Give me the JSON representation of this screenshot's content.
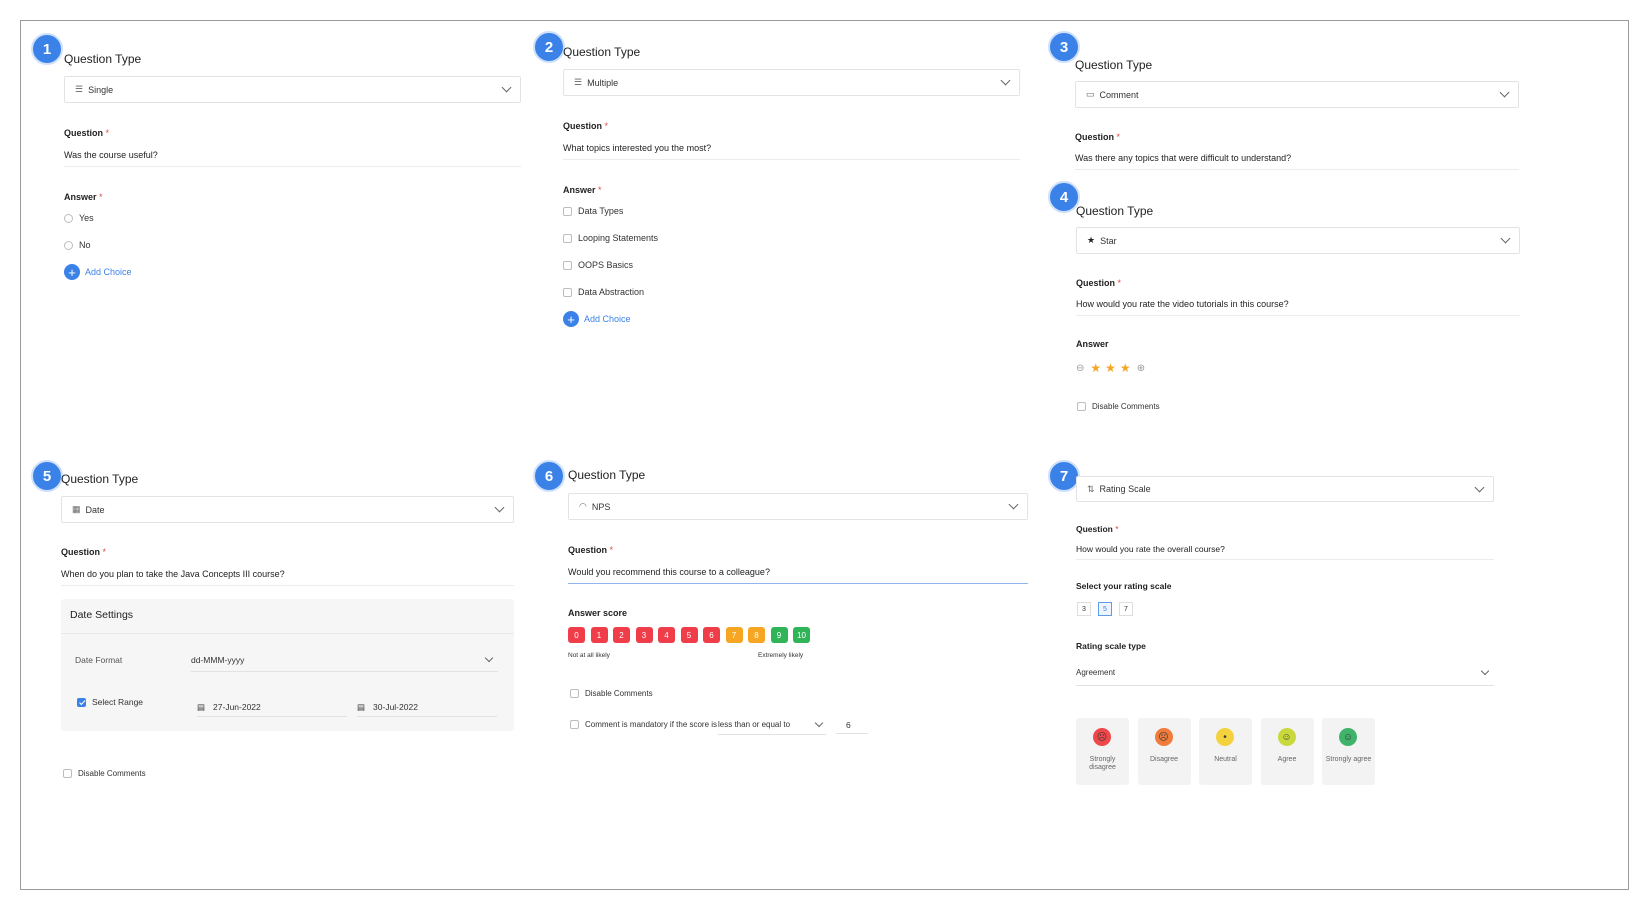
{
  "panel1": {
    "badge": "1",
    "question_type_label": "Question Type",
    "type_value": "Single",
    "type_icon": "list-icon",
    "question_label": "Question",
    "required_mark": "*",
    "question_text": "Was the course useful?",
    "answer_label": "Answer",
    "choices": [
      "Yes",
      "No"
    ],
    "add_choice": "Add Choice"
  },
  "panel2": {
    "badge": "2",
    "question_type_label": "Question Type",
    "type_value": "Multiple",
    "type_icon": "list-icon",
    "question_label": "Question",
    "required_mark": "*",
    "question_text": "What topics interested you the most?",
    "answer_label": "Answer",
    "choices": [
      "Data Types",
      "Looping Statements",
      "OOPS Basics",
      "Data Abstraction"
    ],
    "add_choice": "Add Choice"
  },
  "panel3": {
    "badge": "3",
    "question_type_label": "Question Type",
    "type_value": "Comment",
    "type_icon": "comment-icon",
    "question_label": "Question",
    "required_mark": "*",
    "question_text": "Was there any topics that were difficult to understand?"
  },
  "panel4": {
    "badge": "4",
    "question_type_label": "Question Type",
    "type_value": "Star",
    "type_icon": "star-icon",
    "question_label": "Question",
    "required_mark": "*",
    "question_text": "How would you rate the video tutorials in this course?",
    "answer_label": "Answer",
    "star_count": 3,
    "disable_comments": "Disable Comments"
  },
  "panel5": {
    "badge": "5",
    "question_type_label": "Question Type",
    "type_value": "Date",
    "type_icon": "calendar-icon",
    "question_label": "Question",
    "required_mark": "*",
    "question_text": "When do you plan to take the Java Concepts III course?",
    "date_settings_title": "Date Settings",
    "date_format_label": "Date Format",
    "date_format_value": "dd-MMM-yyyy",
    "select_range_label": "Select Range",
    "select_range_checked": true,
    "start_date": "27-Jun-2022",
    "end_date": "30-Jul-2022",
    "disable_comments": "Disable Comments"
  },
  "panel6": {
    "badge": "6",
    "question_type_label": "Question Type",
    "type_value": "NPS",
    "type_icon": "gauge-icon",
    "question_label": "Question",
    "required_mark": "*",
    "question_text": "Would you recommend this course to a colleague?",
    "answer_score_label": "Answer score",
    "scores": [
      {
        "value": "0",
        "color": "#ef3e4a"
      },
      {
        "value": "1",
        "color": "#ef3e4a"
      },
      {
        "value": "2",
        "color": "#ef3e4a"
      },
      {
        "value": "3",
        "color": "#ef3e4a"
      },
      {
        "value": "4",
        "color": "#ef3e4a"
      },
      {
        "value": "5",
        "color": "#ef3e4a"
      },
      {
        "value": "6",
        "color": "#ef3e4a"
      },
      {
        "value": "7",
        "color": "#f6a623"
      },
      {
        "value": "8",
        "color": "#f6a623"
      },
      {
        "value": "9",
        "color": "#2fb457"
      },
      {
        "value": "10",
        "color": "#2fb457"
      }
    ],
    "low_label": "Not at all likely",
    "high_label": "Extremely likely",
    "disable_comments": "Disable Comments",
    "mandatory_text": "Comment is mandatory if the score is",
    "condition_value": "less than or equal to",
    "condition_number": "6"
  },
  "panel7": {
    "badge": "7",
    "type_value": "Rating Scale",
    "type_icon": "rating-scale-icon",
    "question_label": "Question",
    "required_mark": "*",
    "question_text": "How would you rate the overall course?",
    "scale_label": "Select your rating scale",
    "scale_options": [
      "3",
      "5",
      "7"
    ],
    "scale_selected": "5",
    "scale_type_label": "Rating scale type",
    "scale_type_value": "Agreement",
    "faces": [
      {
        "label": "Strongly disagree",
        "color": "#f0474b",
        "icon": "very-angry-face-icon",
        "glyph": "☹"
      },
      {
        "label": "Disagree",
        "color": "#f07b3a",
        "icon": "angry-face-icon",
        "glyph": "☹"
      },
      {
        "label": "Neutral",
        "color": "#f3d23e",
        "icon": "neutral-face-icon",
        "glyph": "•"
      },
      {
        "label": "Agree",
        "color": "#c9d83c",
        "icon": "smile-face-icon",
        "glyph": "☺"
      },
      {
        "label": "Strongly agree",
        "color": "#3fb36a",
        "icon": "happy-face-icon",
        "glyph": "☺"
      }
    ]
  }
}
